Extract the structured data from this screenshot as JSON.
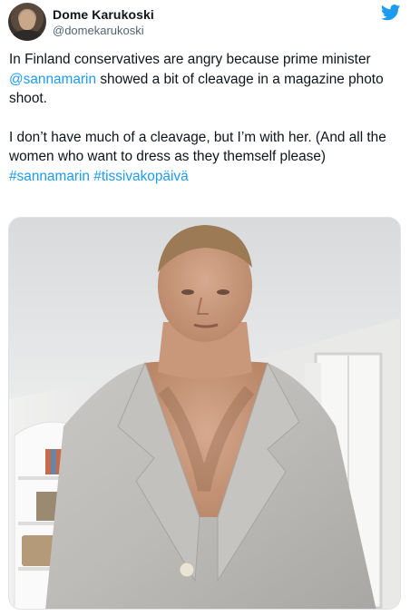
{
  "author": {
    "display_name": "Dome Karukoski",
    "handle": "@domekarukoski"
  },
  "platform_icon": "twitter-bird-icon",
  "tweet": {
    "line1_before": "In Finland conservatives are angry because prime minister ",
    "mention": "@sannamarin",
    "line1_after": " showed a bit of cleavage in a magazine photo shoot.",
    "line2": "I don’t have much of a cleavage, but I’m with her. (And all the women who want to dress as they themself please)",
    "hashtag1": "#sannamarin",
    "hashtag2": "#tissivakopäivä"
  },
  "colors": {
    "link": "#1d9bf0",
    "text": "#0f1419",
    "secondary": "#536471"
  }
}
